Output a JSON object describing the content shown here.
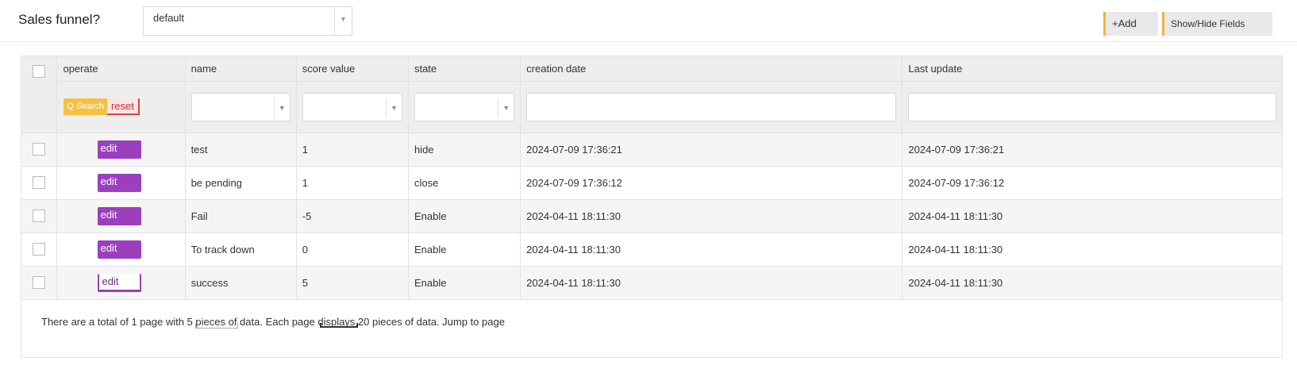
{
  "toolbar": {
    "funnel_label": "Sales funnel?",
    "funnel_select_value": "default",
    "add_label": "+Add",
    "show_hide_label": "Show/Hide Fields"
  },
  "table": {
    "columns": {
      "operate": "operate",
      "name": "name",
      "score": "score value",
      "state": "state",
      "created": "creation date",
      "updated": "Last update"
    },
    "search_label": "Q Search",
    "reset_label": "reset",
    "edit_label": "edit",
    "rows": [
      {
        "name": "test",
        "score": "1",
        "state": "hide",
        "created": "2024-07-09 17:36:21",
        "updated": "2024-07-09 17:36:21"
      },
      {
        "name": "be pending",
        "score": "1",
        "state": "close",
        "created": "2024-07-09 17:36:12",
        "updated": "2024-07-09 17:36:12"
      },
      {
        "name": "Fail",
        "score": "-5",
        "state": "Enable",
        "created": "2024-04-11 18:11:30",
        "updated": "2024-04-11 18:11:30"
      },
      {
        "name": "To track down",
        "score": "0",
        "state": "Enable",
        "created": "2024-04-11 18:11:30",
        "updated": "2024-04-11 18:11:30"
      },
      {
        "name": "success",
        "score": "5",
        "state": "Enable",
        "created": "2024-04-11 18:11:30",
        "updated": "2024-04-11 18:11:30"
      }
    ]
  },
  "footer": {
    "pagination_text": "There are a total of 1 page with 5 pieces of data. Each page displays 20 pieces of data. Jump to page"
  }
}
